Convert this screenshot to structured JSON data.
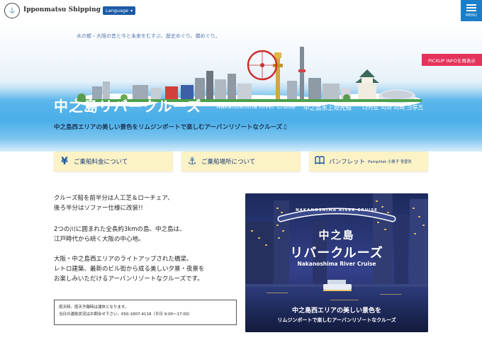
{
  "header": {
    "brand": "Ipponmatsu Shipping Co.,Ltd",
    "language_label": "Language",
    "menu_label": "MENU"
  },
  "hero": {
    "tagline": "水の都・大阪の昔と今と未来をむすぶ、歴史めぐり、橋めぐり。",
    "pickup_label": "PICKUP INFOを再表示",
    "title": "中之島リバークルーズ",
    "title_en": "Nakanoshima River Cruise",
    "title_zh": "中之島水上观光船",
    "title_ko": "나카노 시마 리버 크루즈",
    "description": "中之島西エリアの美しい景色をリムジンボートで楽しむアーバンリゾートなクルーズ♫"
  },
  "info_buttons": [
    {
      "icon": "yen-icon",
      "label": "ご乗船料金について",
      "sub": ""
    },
    {
      "icon": "anchor-icon",
      "label": "ご乗船場所について",
      "sub": ""
    },
    {
      "icon": "book-icon",
      "label": "パンフレット",
      "sub": "Pamphlet 小册子 팜플렛"
    }
  ],
  "body": {
    "para1": [
      "クルーズ船を前半分は人工芝＆ローチェア、",
      "後ろ半分はソファー仕様に改装!!"
    ],
    "para2": [
      "2つの川に囲まれた全長約3kmの島、中之島は、",
      "江戸時代から続く大阪の中心地。"
    ],
    "para3": [
      "大阪・中之島西エリアのライトアップされた橋梁、",
      "レトロ建築、最新のビル街から成る美しい夕景・夜景を",
      "お楽しみいただけるアーバンリゾートなクルーズです。"
    ]
  },
  "notice": {
    "line1": "雨天時、雨天予報時は運休となります。",
    "line2": "当日の運航状況はお問合せ下さい。050-1807-4118（平日 9:00〜17:00）"
  },
  "photo": {
    "arch_text": "NAKANOSHIMA RIVER CRUISE",
    "title1": "中之島",
    "title2": "リバークルーズ",
    "title_en": "Nakanoshima River Cruise",
    "caption1": "中之島西エリアの美しい景色を",
    "caption2": "リムジンボートで楽しむアーバンリゾートなクルーズ"
  },
  "colors": {
    "brand_blue": "#1b5ba6",
    "menu_blue": "#1a7ec8",
    "pickup_pink": "#e5325b",
    "button_yellow": "#fbf2c6"
  }
}
